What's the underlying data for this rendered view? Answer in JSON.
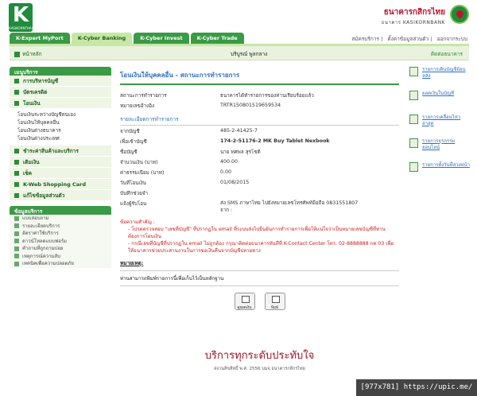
{
  "header": {
    "logo_text": "KASIKORNTHAI",
    "bank_thai": "ธนาคารกสิกรไทย",
    "bank_eng": "ธนาคาร KASIKORNBANK",
    "tabs": [
      {
        "label": "K-Expert MyPort"
      },
      {
        "label": "K-Cyber Banking"
      },
      {
        "label": "K-Cyber Invest"
      },
      {
        "label": "K-Cyber Trade"
      }
    ],
    "links": [
      "สมัครบริการ",
      "ตั้งค่าข้อมูลส่วนตัว",
      "ออกจากระบบ"
    ]
  },
  "subbar": {
    "home": "หน้าหลัก",
    "user": "บริบูรณ์ พูลกลาง",
    "contact": "ติดต่อธนาคาร"
  },
  "sidebar": {
    "menu_title": "เมนูบริการ",
    "items": [
      {
        "label": "การบริหารบัญชี"
      },
      {
        "label": "บัตรเครดิต"
      },
      {
        "label": "โอนเงิน"
      }
    ],
    "sub_items": [
      "โอนเงินระหว่างบัญชีตนเอง",
      "โอนเงินให้บุคคลอื่น",
      "โอนเงินต่างธนาคาร",
      "โอนเงินต่างประเทศ"
    ],
    "items2": [
      {
        "label": "ชำระค่าสินค้าและบริการ"
      },
      {
        "label": "เติมเงิน"
      },
      {
        "label": "เช็ค"
      },
      {
        "label": "K-Web Shopping Card"
      },
      {
        "label": "แก้ไขข้อมูลส่วนตัว"
      }
    ],
    "svc_title": "ข้อมูลบริการ",
    "svc_items": [
      "แบบสอบถาม",
      "รายละเอียดบริการ",
      "อัตราค่าใช้บริการ",
      "ดาวน์โหลดแบบฟอร์ม",
      "คำถามที่ถูกถามบ่อย",
      "เหตุการณ์ความลับ",
      "เทคนิคเพื่อความปลอดภัย"
    ]
  },
  "main": {
    "title": "โอนเงินให้บุคคลอื่น - สถานะการทำรายการ",
    "status_label": "สถานะการทำรายการ",
    "status_value": "ธนาคารได้ทำรายการของท่านเรียบร้อยแล้ว",
    "ref_label": "หมายเลขอ้างอิง",
    "ref_value": "TRTR150801519659534",
    "detail_title": "รายละเอียดการทำรายการ",
    "from_label": "จากบัญชี",
    "from_value": "485-2-41425-7",
    "to_label": "เพื่อเข้าบัญชี",
    "to_value": "174-2-51176-2 MK Buy Tablet Nexbook",
    "name_label": "ชื่อบัญชี",
    "name_value": "นาย ทศพล สุรโชติ",
    "amount_label": "จำนวนเงิน (บาท)",
    "amount_value": "400.00",
    "fee_label": "ค่าธรรมเนียม (บาท)",
    "fee_value": "0.00",
    "date_label": "วันที่โอนเงิน",
    "date_value": "01/08/2015",
    "memo_label": "บันทึกช่วยจำ",
    "memo_value": "",
    "notify_label": "แจ้งผู้รับโอน",
    "notify_value": "ส่ง SMS ภาษาไทย ไปยังหมายเลขโทรศัพท์มือถือ 0831551807",
    "notify_from": "จาก :",
    "notes_head": "ข้อความสำคัญ :",
    "note1": "- โปรดตรวจสอบ \"เลขที่บัญชี\" ที่ปรากฏใน email ที่ระบบส่งไปยืนยันการทำรายการเพื่อให้แน่ใจว่าเป็นหมายเลขบัญชีที่ท่านต้องการโอนเงิน",
    "note2": "- กรณีเลขที่บัญชีที่ปรากฏใน email ไม่ถูกต้อง กรุณาติดต่อธนาคารทันทีที่ K-Contact Center โทร. 02-8888888 กด 03 เพื่อให้ธนาคารช่วยประสานงานในการขอเงินคืนจากบัญชีปลายทาง",
    "remark_head": "หมายเหตุ:",
    "remark": "ท่านสามารถพิมพ์รายการนี้เพื่อเก็บไว้เป็นหลักฐาน",
    "btn_view": "ดูยอดเงิน",
    "btn_print": "พิมพ์"
  },
  "right": {
    "links": [
      "รายการเดินบัญชีย้อนหลัง",
      "ยอดเงินในบัญชี",
      "รายการเคลื่อนไหวล่าสุด",
      "รายการธุรกรรมออนไลน์",
      "รายการตั้งวันที่ล่วงหน้า"
    ]
  },
  "footer": {
    "slogan": "บริการทุกระดับประทับใจ",
    "copy": "สงวนลิขสิทธิ์ พ.ศ. 2556 บมจ.ธนาคารกสิกรไทย"
  },
  "watermark": "[977x781] https://upic.me/"
}
